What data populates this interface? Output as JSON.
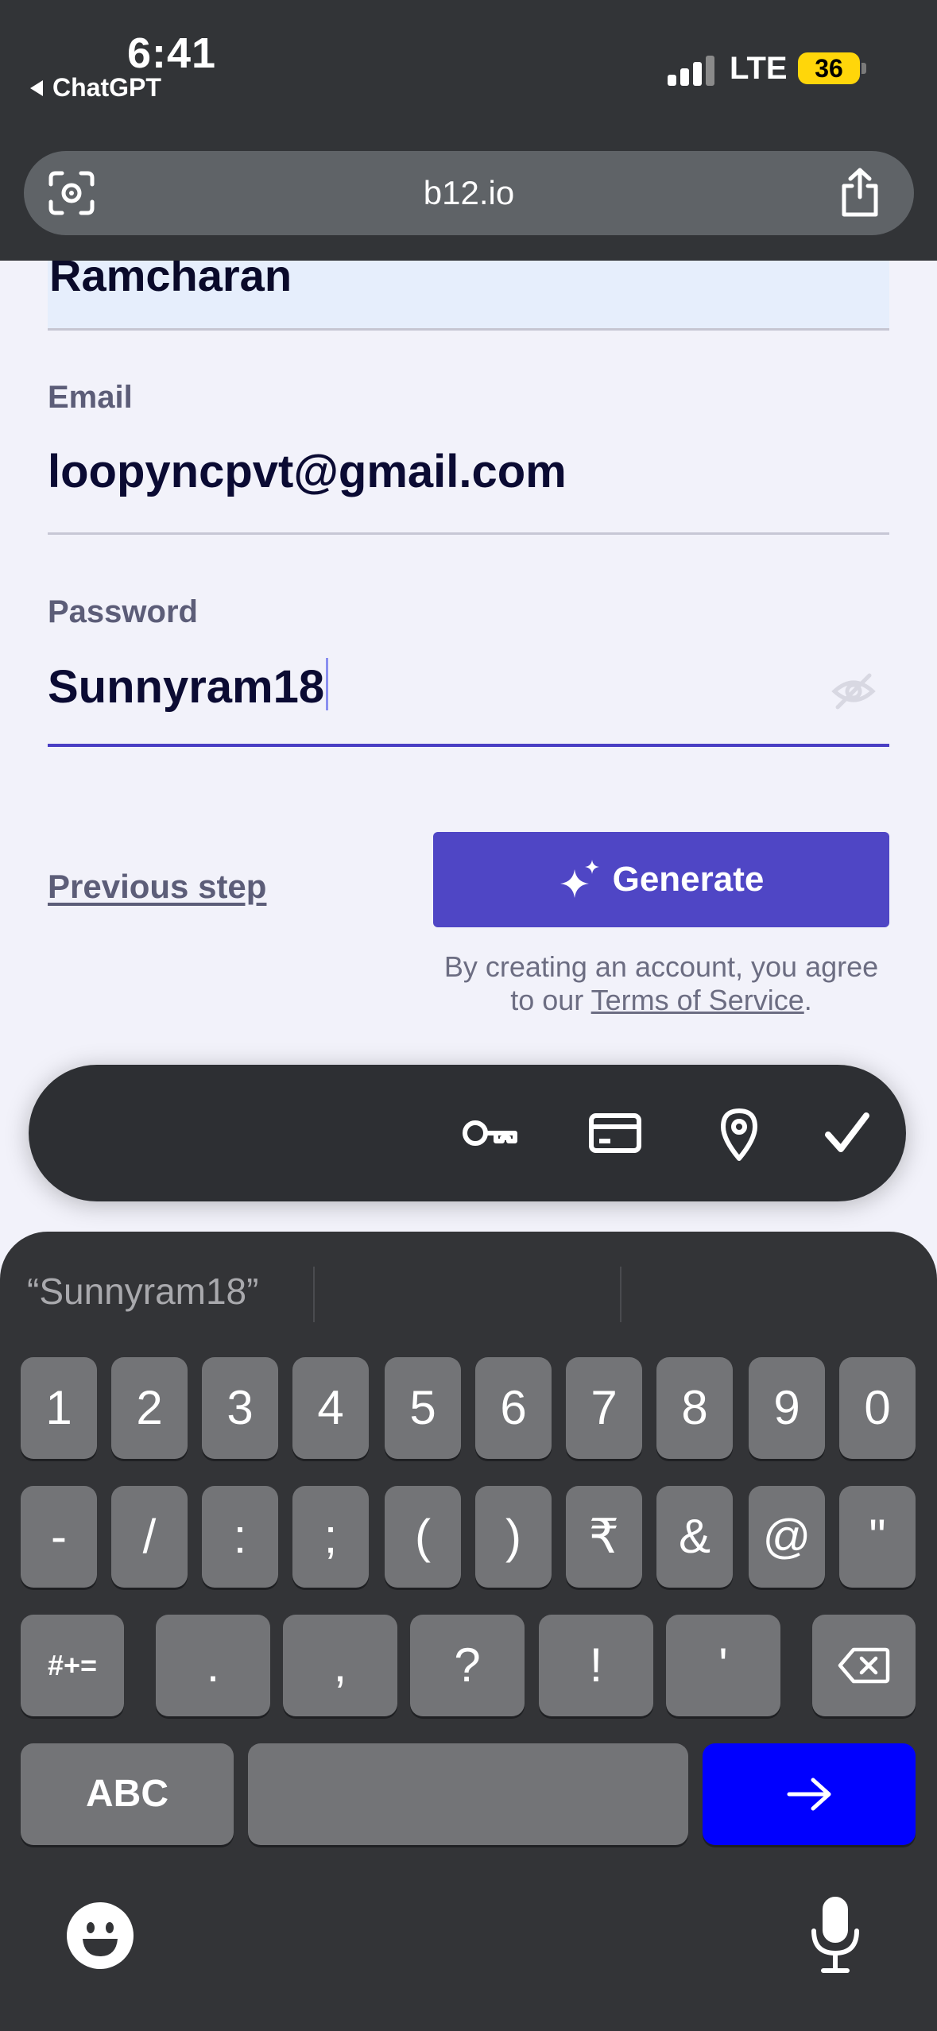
{
  "status_bar": {
    "time": "6:41",
    "back_app": "ChatGPT",
    "network": "LTE",
    "battery": "36"
  },
  "browser": {
    "url": "b12.io",
    "icons": [
      "visual-lookup-icon",
      "share-icon"
    ]
  },
  "form": {
    "name_value": "Ramcharan",
    "email": {
      "label": "Email",
      "value": "loopyncpvt@gmail.com"
    },
    "password": {
      "label": "Password",
      "value": "Sunnyram18",
      "visibility_icon": "eye-off-icon"
    },
    "previous_step": "Previous step",
    "generate_label": "Generate",
    "terms_prefix": "By creating an account, you agree to our ",
    "terms_link": "Terms of Service",
    "terms_suffix": "."
  },
  "autofill_bar": {
    "icons": [
      "key-icon",
      "credit-card-icon",
      "location-pin-icon",
      "checkmark-icon"
    ]
  },
  "keyboard": {
    "suggestion": "“Sunnyram18”",
    "row1": [
      "1",
      "2",
      "3",
      "4",
      "5",
      "6",
      "7",
      "8",
      "9",
      "0"
    ],
    "row2": [
      "-",
      "/",
      ":",
      ";",
      "(",
      ")",
      "₹",
      "&",
      "@",
      "\""
    ],
    "row3": [
      ".",
      ",",
      "?",
      "!",
      "'"
    ],
    "shift_label": "#+=",
    "abc_label": "ABC",
    "accent_color": "#0000ff"
  }
}
